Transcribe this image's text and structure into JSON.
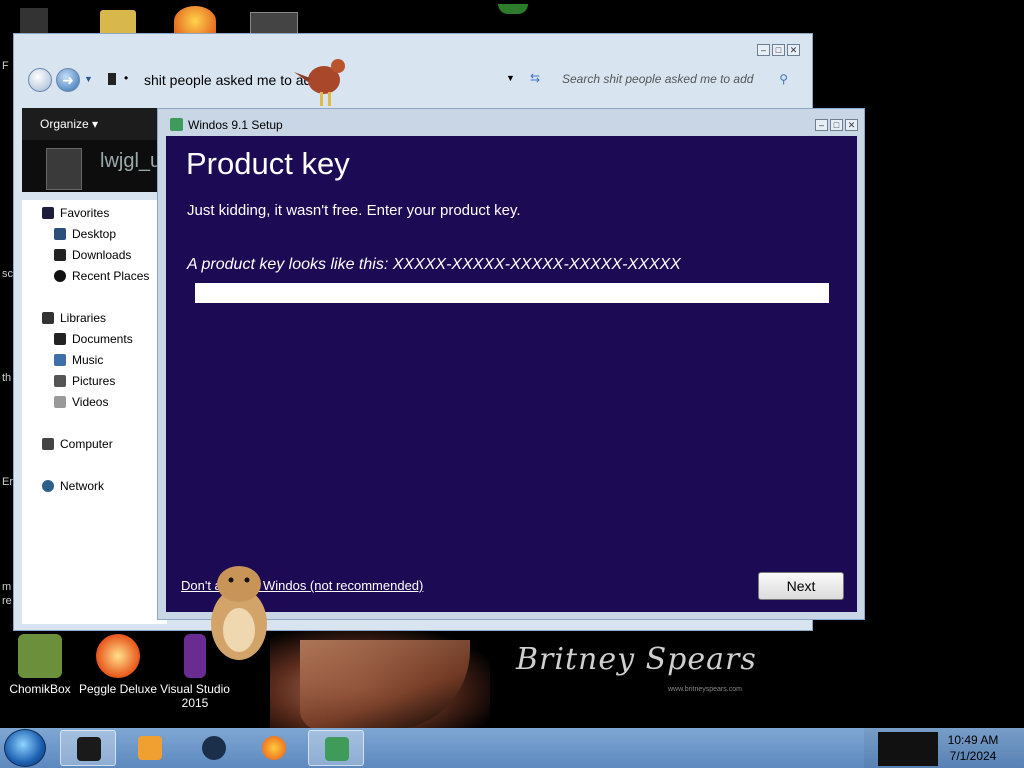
{
  "desktop": {
    "icons": [
      {
        "label": "ChomikBox"
      },
      {
        "label": "Peggle Deluxe"
      },
      {
        "label": "Visual Studio 2015"
      }
    ],
    "left_edge_text": [
      "F",
      "sc",
      "th",
      "Er",
      "m re"
    ],
    "wallpaper_text": "Britney Spears",
    "wallpaper_subtext": "www.britneyspears.com"
  },
  "explorer": {
    "address": "shit people asked me to add",
    "search_placeholder": "Search shit people asked me to add",
    "organize_label": "Organize",
    "folder_name": "lwjgl_u",
    "nav": {
      "favorites": "Favorites",
      "desktop": "Desktop",
      "downloads": "Downloads",
      "recent_places": "Recent Places",
      "libraries": "Libraries",
      "documents": "Documents",
      "music": "Music",
      "pictures": "Pictures",
      "videos": "Videos",
      "computer": "Computer",
      "network": "Network"
    }
  },
  "setup": {
    "window_title": "Windos 9.1 Setup",
    "heading": "Product key",
    "subtitle": "Just kidding, it wasn't free. Enter your product key.",
    "example": "A product key looks like this: XXXXX-XXXXX-XXXXX-XXXXX-XXXXX",
    "product_key_value": "",
    "skip_link": "Don't activate Windos (not recommended)",
    "next_label": "Next"
  },
  "taskbar": {
    "clock_time": "10:49 AM",
    "clock_date": "7/1/2024"
  },
  "colors": {
    "setup_background": "#1d0a55",
    "taskbar": "#6d97c9",
    "window_frame": "#d9e4f1"
  }
}
